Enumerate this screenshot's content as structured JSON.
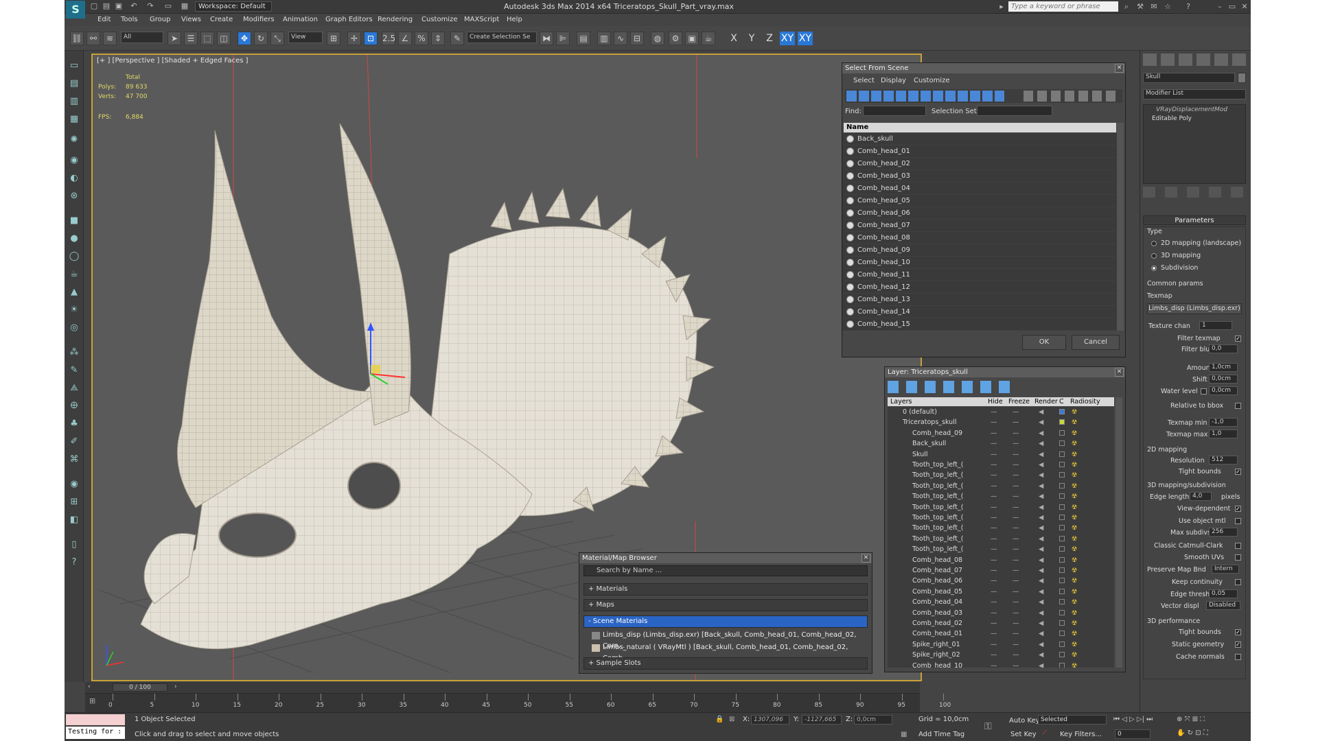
{
  "window": {
    "title": "Autodesk 3ds Max  2014 x64     Triceratops_Skull_Part_vray.max",
    "workspace": "Workspace: Default",
    "search_placeholder": "Type a keyword or phrase"
  },
  "menu": [
    "Edit",
    "Tools",
    "Group",
    "Views",
    "Create",
    "Modifiers",
    "Animation",
    "Graph Editors",
    "Rendering",
    "Customize",
    "MAXScript",
    "Help"
  ],
  "toolbar": {
    "selection_filter": "All",
    "ref_coord": "View",
    "selection_set": "Create Selection Se",
    "snap_label": "2.5",
    "axes": [
      "X",
      "Y",
      "Z",
      "XY",
      "XY"
    ]
  },
  "viewport": {
    "label": "[+ ] [Perspective ] [Shaded + Edged Faces ]",
    "stats_title": "Total",
    "polys_label": "Polys:",
    "polys_value": "89 633",
    "verts_label": "Verts:",
    "verts_value": "47 700",
    "fps_label": "FPS:",
    "fps_value": "6,884"
  },
  "select_from_scene": {
    "title": "Select From Scene",
    "tabs": [
      "Select",
      "Display",
      "Customize"
    ],
    "find_label": "Find:",
    "selection_set_label": "Selection Set:",
    "column_name": "Name",
    "items": [
      "Back_skull",
      "Comb_head_01",
      "Comb_head_02",
      "Comb_head_03",
      "Comb_head_04",
      "Comb_head_05",
      "Comb_head_06",
      "Comb_head_07",
      "Comb_head_08",
      "Comb_head_09",
      "Comb_head_10",
      "Comb_head_11",
      "Comb_head_12",
      "Comb_head_13",
      "Comb_head_14",
      "Comb_head_15"
    ],
    "ok": "OK",
    "cancel": "Cancel"
  },
  "layer_manager": {
    "title": "Layer: Triceratops_skull",
    "columns": [
      "Layers",
      "Hide",
      "Freeze",
      "Render",
      "C",
      "Radiosity"
    ],
    "layers": [
      "0 (default)",
      "Triceratops_skull"
    ],
    "objects": [
      "Comb_head_09",
      "Back_skull",
      "Skull",
      "Tooth_top_left_(",
      "Tooth_top_left_(",
      "Tooth_top_left_(",
      "Tooth_top_left_(",
      "Tooth_top_left_(",
      "Tooth_top_left_(",
      "Tooth_top_left_(",
      "Tooth_top_left_(",
      "Tooth_top_left_(",
      "Comb_head_08",
      "Comb_head_07",
      "Comb_head_06",
      "Comb_head_05",
      "Comb_head_04",
      "Comb_head_03",
      "Comb_head_02",
      "Comb_head_01",
      "Spike_right_01",
      "Spike_right_02",
      "Comb_head_10"
    ]
  },
  "material_browser": {
    "title": "Material/Map Browser",
    "search_placeholder": "Search by Name ...",
    "groups": [
      "+ Materials",
      "+ Maps",
      "- Scene Materials",
      "+ Sample Slots"
    ],
    "scene_materials": [
      "Limbs_disp (Limbs_disp.exr) [Back_skull, Comb_head_01, Comb_head_02, Com...",
      "Limbs_natural  ( VRayMtl ) [Back_skull, Comb_head_01, Comb_head_02, Comb..."
    ]
  },
  "command_panel": {
    "object_name": "Skull",
    "modifier_list": "Modifier List",
    "stack": [
      "VRayDisplacementMod",
      "Editable Poly"
    ],
    "parameters_rollout": "Parameters",
    "type_label": "Type",
    "type_options": [
      "2D mapping (landscape)",
      "3D mapping",
      "Subdivision"
    ],
    "common_params": "Common params",
    "texmap_label": "Texmap",
    "texmap_value": "Limbs_disp (Limbs_disp.exr)",
    "texture_chan_label": "Texture chan",
    "texture_chan_value": "1",
    "filter_texmap": "Filter texmap",
    "filter_blur_label": "Filter blur",
    "filter_blur_value": "0,0",
    "amount_label": "Amount",
    "amount_value": "1,0cm",
    "shift_label": "Shift",
    "shift_value": "0,0cm",
    "water_level_label": "Water level",
    "water_level_value": "0,0cm",
    "relative_to_bbox": "Relative to bbox",
    "texmap_min_label": "Texmap min",
    "texmap_min_value": "-1,0",
    "texmap_max_label": "Texmap max",
    "texmap_max_value": "1,0",
    "mapping2d_label": "2D mapping",
    "resolution_label": "Resolution",
    "resolution_value": "512",
    "tight_bounds": "Tight bounds",
    "mapping3d_label": "3D mapping/subdivision",
    "edge_length_label": "Edge length",
    "edge_length_value": "4,0",
    "pixels_label": "pixels",
    "view_dependent": "View-dependent",
    "use_object_mtl": "Use object mtl",
    "max_subdivs_label": "Max subdivs",
    "max_subdivs_value": "256",
    "classic_catmull": "Classic Catmull-Clark",
    "smooth_uvs": "Smooth UVs",
    "preserve_map_bnd_label": "Preserve Map Bnd",
    "preserve_map_bnd_value": "Intern",
    "keep_continuity": "Keep continuity",
    "edge_thresh_label": "Edge thresh",
    "edge_thresh_value": "0,05",
    "vector_displ_label": "Vector displ",
    "vector_displ_value": "Disabled",
    "performance_label": "3D performance",
    "tight_bounds2": "Tight bounds",
    "static_geometry": "Static geometry",
    "cache_normals": "Cache normals"
  },
  "timeline": {
    "slider_label": "0 / 100",
    "ticks": [
      "0",
      "5",
      "10",
      "15",
      "20",
      "25",
      "30",
      "35",
      "40",
      "45",
      "50",
      "55",
      "60",
      "65",
      "70",
      "75",
      "80",
      "85",
      "90",
      "95",
      "100"
    ]
  },
  "status": {
    "maxscript_text": "Testing for :",
    "selected_count": "1 Object Selected",
    "prompt": "Click and drag to select and move objects",
    "x_label": "X:",
    "x_value": "1307,096",
    "y_label": "Y:",
    "y_value": "-1127,665",
    "z_label": "Z:",
    "z_value": "0,0cm",
    "grid": "Grid = 10,0cm",
    "add_time_tag": "Add Time Tag",
    "auto_key": "Auto Key",
    "set_key": "Set Key",
    "selected_dropdown": "Selected",
    "key_filters": "Key Filters...",
    "frame_value": "0"
  }
}
